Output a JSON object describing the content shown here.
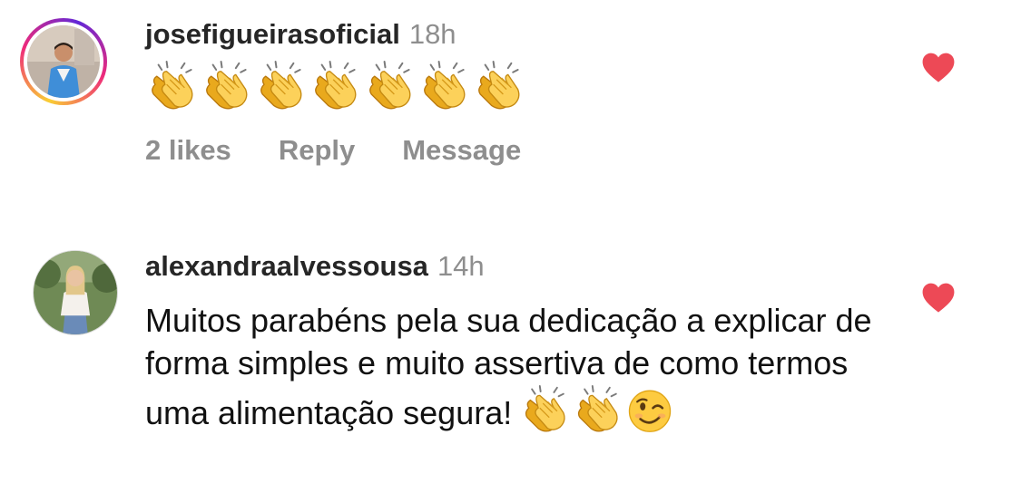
{
  "comments": [
    {
      "username": "josefigueirasoficial",
      "time": "18h",
      "emojis": [
        "clapping-hands",
        "clapping-hands",
        "clapping-hands",
        "clapping-hands",
        "clapping-hands",
        "clapping-hands",
        "clapping-hands"
      ],
      "likes_label": "2 likes",
      "reply_label": "Reply",
      "message_label": "Message",
      "liked": true,
      "has_story_ring": true
    },
    {
      "username": "alexandraalvessousa",
      "time": "14h",
      "text": "Muitos parabéns pela sua dedicação a explicar de forma simples e muito assertiva de como termos uma alimentação segura!",
      "trailing_emojis": [
        "clapping-hands",
        "clapping-hands",
        "winking-face"
      ],
      "liked": true,
      "has_story_ring": false
    }
  ],
  "colors": {
    "heart": "#ed4956",
    "muted": "#8e8e8e",
    "username": "#262626",
    "text": "#111111",
    "story_gradient": [
      "#f9ce34",
      "#ee2a7b",
      "#6228d7"
    ]
  }
}
